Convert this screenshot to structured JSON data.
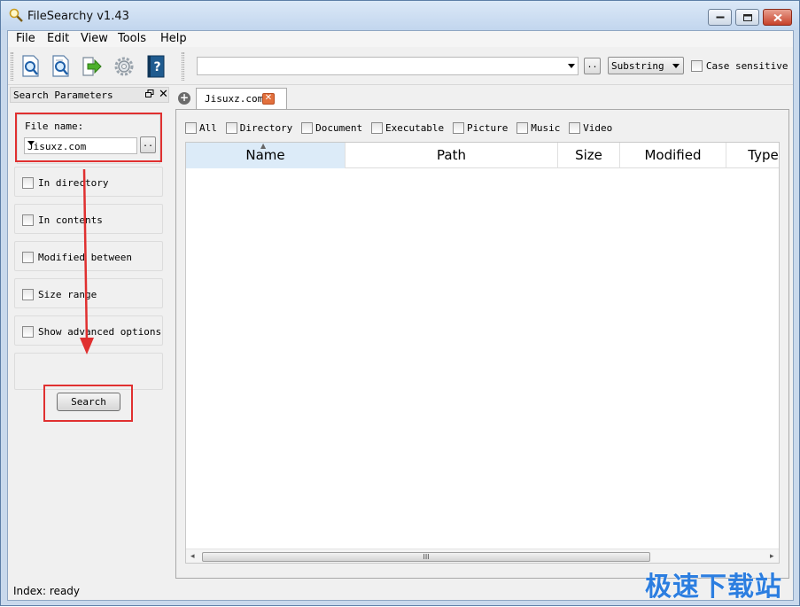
{
  "window": {
    "title": "FileSearchy v1.43",
    "minimize_icon": "minimize-icon",
    "maximize_icon": "maximize-icon",
    "close_icon": "close-icon"
  },
  "menu": {
    "items": [
      "File",
      "Edit",
      "View",
      "Tools",
      "Help"
    ]
  },
  "toolbar": {
    "icons": [
      "find-file-icon",
      "find-content-icon",
      "export-arrow-icon",
      "settings-gear-icon",
      "help-book-icon"
    ],
    "search_value": "",
    "browse_label": "..",
    "mode_value": "Substring",
    "case_sensitive_label": "Case sensitive",
    "case_sensitive_checked": false
  },
  "search_params": {
    "title": "Search Parameters",
    "file_name_label": "File name:",
    "file_name_value": "Jisuxz.com",
    "browse_label": "..",
    "sections": [
      {
        "label": "In directory",
        "checked": false
      },
      {
        "label": "In contents",
        "checked": false
      },
      {
        "label": "Modified between",
        "checked": false
      },
      {
        "label": "Size range",
        "checked": false
      },
      {
        "label": "Show advanced options",
        "checked": false
      }
    ],
    "search_button": "Search"
  },
  "results": {
    "tab_label": "Jisuxz.com",
    "filters": [
      "All",
      "Directory",
      "Document",
      "Executable",
      "Picture",
      "Music",
      "Video"
    ],
    "columns": [
      "Name",
      "Path",
      "Size",
      "Modified",
      "Type"
    ],
    "sorted_column": "Name",
    "scroll_thumb_glyph": "III",
    "rows": []
  },
  "status": {
    "text": "Index: ready"
  },
  "watermark": "极速下载站",
  "colors": {
    "annotation": "#e03030",
    "watermark": "#2c7ee0",
    "sorted_header": "#dcebf8"
  }
}
